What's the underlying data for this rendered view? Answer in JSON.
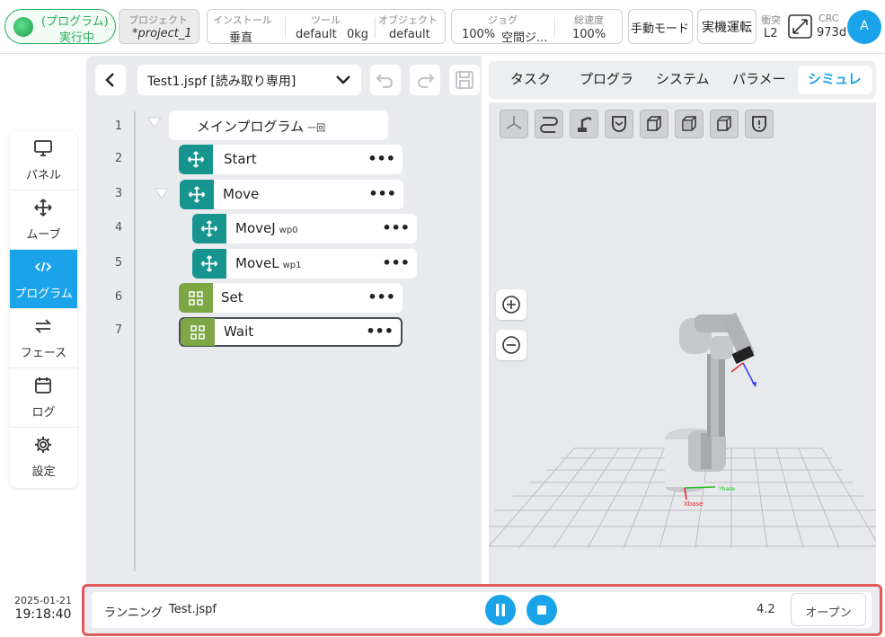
{
  "topbar": {
    "status": {
      "line1": "(プログラム)",
      "line2": "実行中"
    },
    "project": {
      "caption": "プロジェクト",
      "value": "*project_1"
    },
    "install": {
      "caption": "インストール",
      "value": "垂直"
    },
    "tool": {
      "caption": "ツール",
      "value1": "default",
      "value2": "0kg"
    },
    "object": {
      "caption": "オブジェクト",
      "value": "default"
    },
    "jog": {
      "caption": "ジョグ",
      "value1": "100%",
      "value2": "空間ジ..."
    },
    "speed": {
      "caption": "総速度",
      "value": "100%"
    },
    "manual_mode": "手動モード",
    "real_run": "実機運転",
    "collision": {
      "caption": "衝突",
      "value": "L2"
    },
    "crc": {
      "caption": "CRC",
      "value": "973d"
    },
    "avatar": "A"
  },
  "sidebar": {
    "items": [
      {
        "label": "パネル",
        "icon": "monitor-icon"
      },
      {
        "label": "ムーブ",
        "icon": "move-arrows-icon"
      },
      {
        "label": "プログラム",
        "icon": "code-icon",
        "active": true
      },
      {
        "label": "フェース",
        "icon": "swap-icon"
      },
      {
        "label": "ログ",
        "icon": "calendar-icon"
      },
      {
        "label": "設定",
        "icon": "gear-icon"
      }
    ]
  },
  "clock": {
    "date": "2025-01-21",
    "time": "19:18:40"
  },
  "editor": {
    "file": "Test1.jspf [読み取り専用]",
    "lines": [
      "1",
      "2",
      "3",
      "4",
      "5",
      "6",
      "7"
    ],
    "nodes": {
      "main": {
        "label": "メインプログラム",
        "sub": "一回"
      },
      "start": {
        "label": "Start"
      },
      "move": {
        "label": "Move"
      },
      "movej": {
        "label": "MoveJ",
        "sub": "wp0"
      },
      "movel": {
        "label": "MoveL",
        "sub": "wp1"
      },
      "set": {
        "label": "Set"
      },
      "wait": {
        "label": "Wait"
      }
    },
    "dots": "•••"
  },
  "sim": {
    "tabs": [
      "タスク",
      "プログラ",
      "システム",
      "パラメー",
      "シミュレ"
    ],
    "active_tab": "シミュレ",
    "axis_labels": {
      "x": "Xbase",
      "y": "Ybase"
    }
  },
  "status": {
    "running": "ランニング",
    "file": "Test.jspf",
    "version": "4.2",
    "open_label": "オープン"
  },
  "colors": {
    "accent": "#1aa3e8",
    "teal": "#18948f",
    "green": "#7da645",
    "status_border": "#e05a5a",
    "run_green": "#2cae5b"
  }
}
